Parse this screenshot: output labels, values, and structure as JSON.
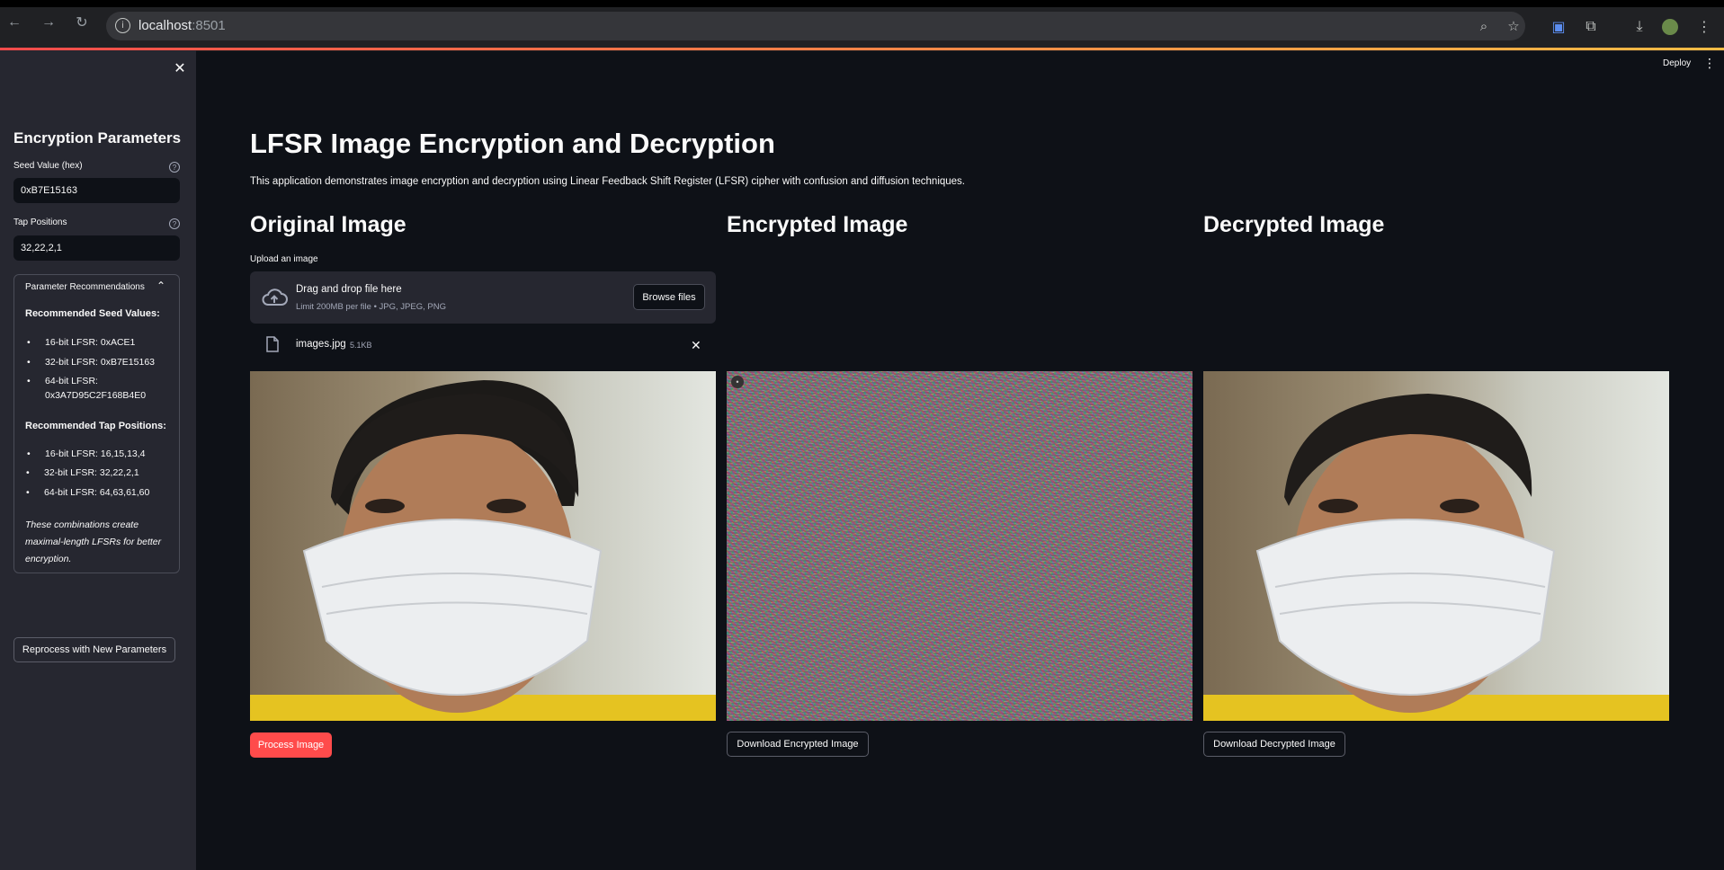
{
  "browser": {
    "url_host": "localhost",
    "url_port": ":8501"
  },
  "sidebar": {
    "title": "Encryption Parameters",
    "seed_label": "Seed Value (hex)",
    "seed_value": "0xB7E15163",
    "tap_label": "Tap Positions",
    "tap_value": "32,22,2,1",
    "expander": {
      "header": "Parameter Recommendations",
      "seed_heading": "Recommended Seed Values:",
      "seeds": [
        {
          "bits": "16-bit LFSR:",
          "value": "0xACE1"
        },
        {
          "bits": "32-bit LFSR:",
          "value": "0xB7E15163"
        },
        {
          "bits": "64-bit LFSR:",
          "value": "0x3A7D95C2F168B4E0"
        }
      ],
      "tap_heading": "Recommended Tap Positions:",
      "taps": [
        {
          "bits": "16-bit LFSR:",
          "value": "16,15,13,4"
        },
        {
          "bits": "32-bit LFSR:",
          "value": "32,22,2,1"
        },
        {
          "bits": "64-bit LFSR:",
          "value": "64,63,61,60"
        }
      ],
      "note": "These combinations create maximal-length LFSRs for better encryption."
    },
    "reprocess_label": "Reprocess with New Parameters"
  },
  "header": {
    "deploy_label": "Deploy"
  },
  "main": {
    "title": "LFSR Image Encryption and Decryption",
    "description": "This application demonstrates image encryption and decryption using Linear Feedback Shift Register (LFSR) cipher with confusion and diffusion techniques.",
    "columns": {
      "original_title": "Original Image",
      "encrypted_title": "Encrypted Image",
      "decrypted_title": "Decrypted Image"
    },
    "uploader": {
      "label": "Upload an image",
      "drag_text": "Drag and drop file here",
      "limit_text": "Limit 200MB per file • JPG, JPEG, PNG",
      "browse_label": "Browse files",
      "file_name": "images.jpg",
      "file_size": "5.1KB"
    },
    "process_label": "Process Image",
    "download_encrypted_label": "Download Encrypted Image",
    "download_decrypted_label": "Download Decrypted Image"
  },
  "icons": {
    "back": "arrow-left-icon",
    "forward": "arrow-right-icon",
    "reload": "reload-icon",
    "close": "close-icon",
    "help": "question-circle-icon",
    "cloud": "cloud-upload-icon",
    "file": "file-icon"
  },
  "colors": {
    "app_bg": "#0e1117",
    "sidebar_bg": "#262730",
    "primary": "#ff4b4b",
    "text": "#fafafa"
  }
}
